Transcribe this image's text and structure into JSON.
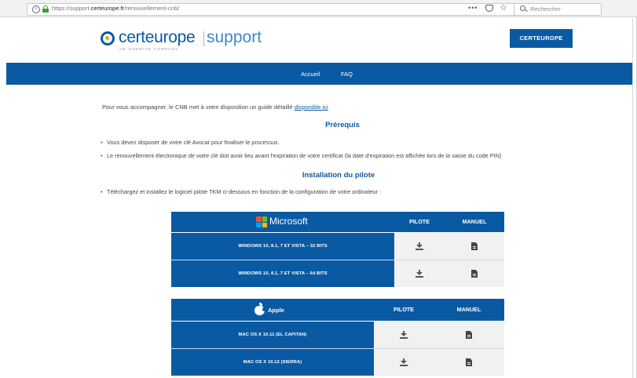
{
  "browser": {
    "url_prefix": "https://support.",
    "url_domain": "certeurope.fr",
    "url_path": "/renouvellement-cnb/",
    "page_actions": "•••",
    "search_placeholder": "Rechercher"
  },
  "header": {
    "logo_name": "certeurope",
    "logo_support": "support",
    "logo_tagline": "AN OODRIVE COMPANY",
    "cta_label": "CERTEUROPE"
  },
  "nav": {
    "items": [
      {
        "label": "Accueil"
      },
      {
        "label": "FAQ"
      }
    ]
  },
  "content": {
    "intro_text": "Pour vous accompagner, le CNB met à votre disposition un guide détaillé ",
    "intro_link": "disponible ici",
    "prerequis_title": "Prérequis",
    "prerequis_bullets": [
      "Vous devez disposer de votre clé Avocat pour finaliser le processus.",
      "Le renouvellement électronique de votre clé doit avoir lieu avant l'expiration de votre certificat (la date d'expiration est affichée lors de la saisie du code PIN)"
    ],
    "install_title": "Installation du pilote",
    "install_bullets": [
      "Téléchargez et installez le logiciel pilote TKM ci-dessous en fonction de la configuration de votre ordinateur :"
    ]
  },
  "tables": {
    "microsoft": {
      "brand": "Microsoft",
      "col_pilote": "PILOTE",
      "col_manuel": "MANUEL",
      "rows": [
        {
          "label": "WINDOWS 10, 8.1, 7 ET VISTA – 32 BITS"
        },
        {
          "label": "WINDOWS 10, 8.1, 7 ET VISTA – 64 BITS"
        }
      ]
    },
    "apple": {
      "brand": "Apple",
      "col_pilote": "PILOTE",
      "col_manuel": "MANUEL",
      "rows": [
        {
          "label": "MAC OS X 10.11 (EL CAPITAN)"
        },
        {
          "label": "MAC OS X 10.12 (SIERRA)"
        }
      ]
    }
  },
  "colors": {
    "brand_blue": "#0a5aa3",
    "accent_orange": "#f3a21b",
    "ms_red": "#f25022",
    "ms_green": "#7fba00",
    "ms_blue": "#00a4ef",
    "ms_yellow": "#ffb900"
  }
}
